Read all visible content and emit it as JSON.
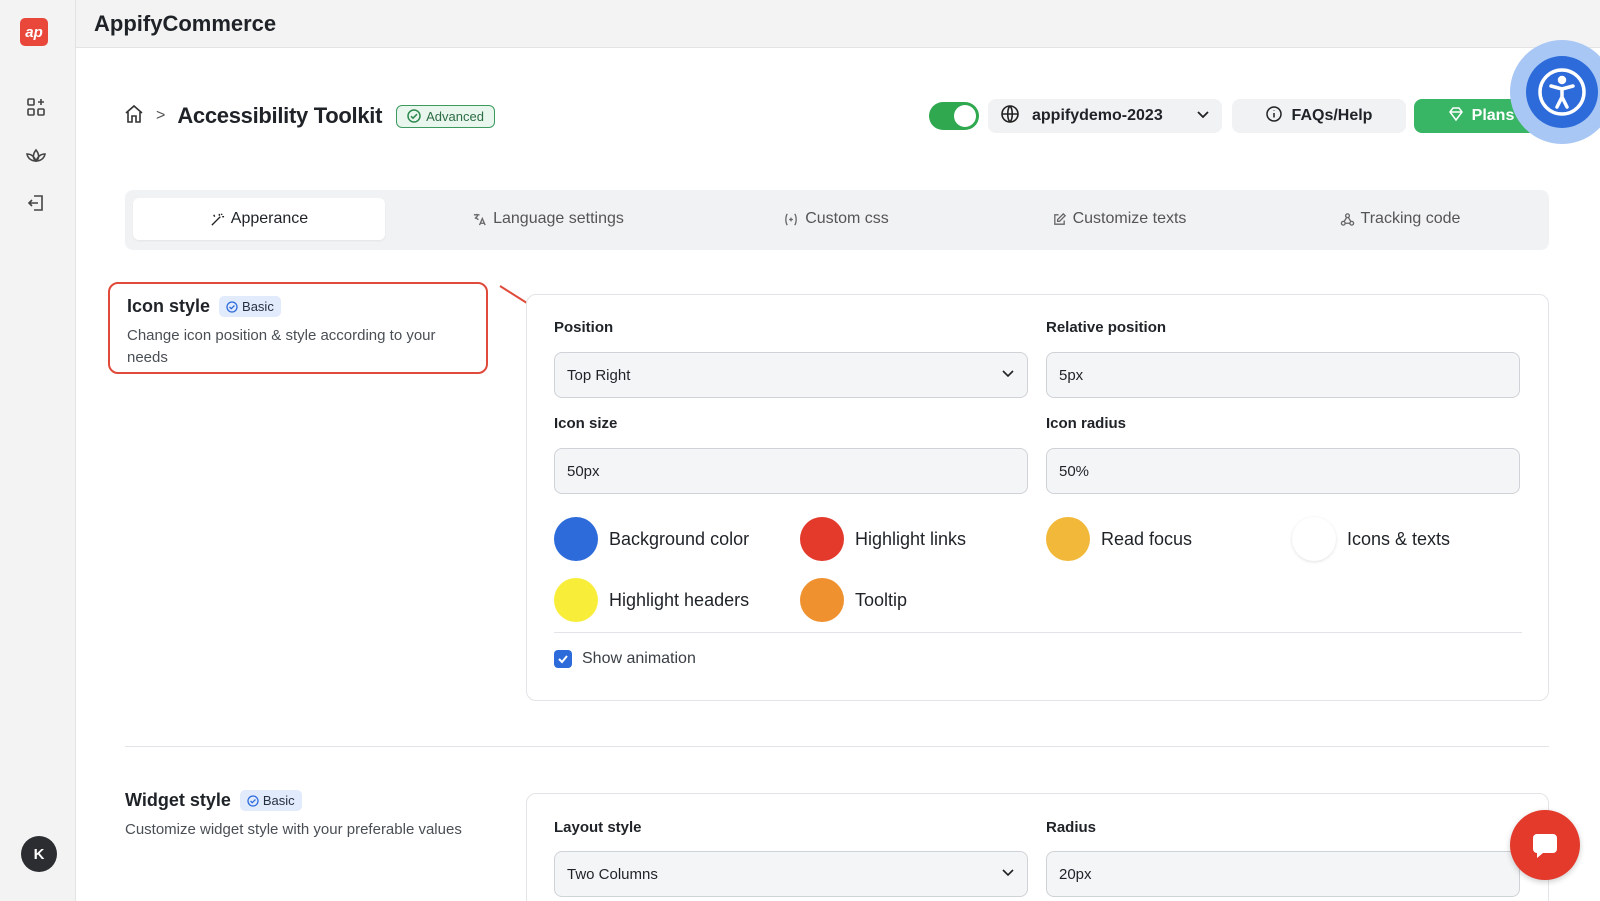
{
  "sidebar": {
    "logo_text": "ap",
    "avatar_initial": "K"
  },
  "topbar": {
    "app_title": "AppifyCommerce"
  },
  "header": {
    "page_title": "Accessibility Toolkit",
    "badge": "Advanced",
    "toggle_on": true,
    "store": "appifydemo-2023",
    "faq_label": "FAQs/Help",
    "plans_label": "Plans"
  },
  "tabs": [
    {
      "label": "Apperance",
      "icon": "magic-wand-icon",
      "active": true
    },
    {
      "label": "Language settings",
      "icon": "translate-icon"
    },
    {
      "label": "Custom css",
      "icon": "code-brackets-icon"
    },
    {
      "label": "Customize texts",
      "icon": "edit-icon"
    },
    {
      "label": "Tracking code",
      "icon": "share-nodes-icon"
    }
  ],
  "icon_style": {
    "title": "Icon style",
    "badge": "Basic",
    "description": "Change icon position & style according to your needs",
    "position_label": "Position",
    "position_value": "Top Right",
    "relative_position_label": "Relative position",
    "relative_position_value": "5px",
    "icon_size_label": "Icon size",
    "icon_size_value": "50px",
    "icon_radius_label": "Icon radius",
    "icon_radius_value": "50%",
    "colors": [
      {
        "label": "Background color",
        "color": "#2d6bdb"
      },
      {
        "label": "Highlight links",
        "color": "#e33a2c"
      },
      {
        "label": "Read focus",
        "color": "#f2b83a"
      },
      {
        "label": "Icons & texts",
        "color": "#ffffff"
      },
      {
        "label": "Highlight headers",
        "color": "#f8ee3a"
      },
      {
        "label": "Tooltip",
        "color": "#f0912f"
      }
    ],
    "show_animation_label": "Show animation",
    "show_animation_checked": true
  },
  "widget_style": {
    "title": "Widget style",
    "badge": "Basic",
    "description": "Customize widget style with your preferable values",
    "layout_label": "Layout style",
    "layout_value": "Two Columns",
    "radius_label": "Radius",
    "radius_value": "20px"
  },
  "colors": {
    "accent_green": "#39b566",
    "accent_blue": "#2d6bdb",
    "highlight_red": "#e04a3a"
  }
}
